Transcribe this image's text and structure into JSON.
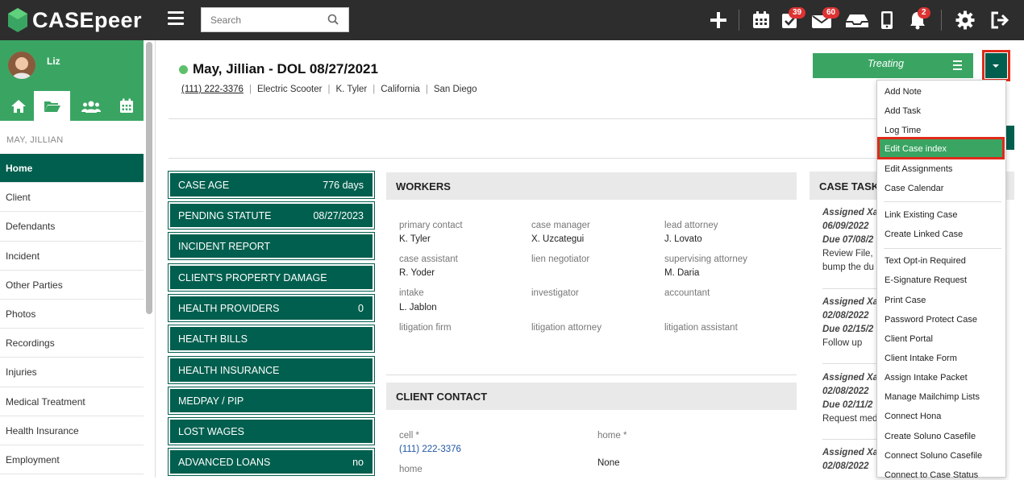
{
  "app": {
    "name": "CASEpeer"
  },
  "search": {
    "placeholder": "Search"
  },
  "topbar": {
    "tasks_badge": "39",
    "mail_badge": "60",
    "notifications_badge": "2"
  },
  "sidebar": {
    "user_name": "Liz",
    "case_name": "MAY, JILLIAN",
    "items": [
      {
        "label": "Home"
      },
      {
        "label": "Client"
      },
      {
        "label": "Defendants"
      },
      {
        "label": "Incident"
      },
      {
        "label": "Other Parties"
      },
      {
        "label": "Photos"
      },
      {
        "label": "Recordings"
      },
      {
        "label": "Injuries"
      },
      {
        "label": "Medical Treatment"
      },
      {
        "label": "Health Insurance"
      },
      {
        "label": "Employment"
      }
    ]
  },
  "case": {
    "title": "May, Jillian - DOL 08/27/2021",
    "phone": "(111) 222-3376",
    "type": "Electric Scooter",
    "worker": "K. Tyler",
    "state": "California",
    "city": "San Diego",
    "status": "Treating"
  },
  "metrics": [
    {
      "label": "CASE AGE",
      "value": "776 days"
    },
    {
      "label": "PENDING STATUTE",
      "value": "08/27/2023"
    },
    {
      "label": "INCIDENT REPORT",
      "value": ""
    },
    {
      "label": "CLIENT'S PROPERTY DAMAGE",
      "value": ""
    },
    {
      "label": "HEALTH PROVIDERS",
      "value": "0"
    },
    {
      "label": "HEALTH BILLS",
      "value": ""
    },
    {
      "label": "HEALTH INSURANCE",
      "value": ""
    },
    {
      "label": "MEDPAY / PIP",
      "value": ""
    },
    {
      "label": "LOST WAGES",
      "value": ""
    },
    {
      "label": "ADVANCED LOANS",
      "value": "no"
    }
  ],
  "workers": {
    "title": "WORKERS",
    "fields": [
      {
        "label": "primary contact",
        "value": "K. Tyler"
      },
      {
        "label": "case manager",
        "value": "X. Uzcategui"
      },
      {
        "label": "lead attorney",
        "value": "J. Lovato"
      },
      {
        "label": "case assistant",
        "value": "R. Yoder"
      },
      {
        "label": "lien negotiator",
        "value": ""
      },
      {
        "label": "supervising attorney",
        "value": "M. Daria"
      },
      {
        "label": "intake",
        "value": "L. Jablon"
      },
      {
        "label": "investigator",
        "value": ""
      },
      {
        "label": "accountant",
        "value": ""
      },
      {
        "label": "litigation firm",
        "value": ""
      },
      {
        "label": "litigation attorney",
        "value": ""
      },
      {
        "label": "litigation assistant",
        "value": ""
      }
    ]
  },
  "client_contact": {
    "title": "CLIENT CONTACT",
    "cell_label": "cell *",
    "cell_value": "(111) 222-3376",
    "home_label": "home *",
    "home_value": "None",
    "home2_label": "home"
  },
  "case_tasks": {
    "title": "CASE TASK",
    "tasks": [
      {
        "assigned": "Assigned Xa",
        "date": "06/09/2022",
        "due": "Due 07/08/2",
        "text1": "Review File,",
        "text2": "bump the du"
      },
      {
        "assigned": "Assigned Xa",
        "date": "02/08/2022",
        "due": "Due 02/15/2",
        "text1": "Follow up",
        "text2": ""
      },
      {
        "assigned": "Assigned Xa",
        "date": "02/08/2022",
        "due": "Due 02/11/2",
        "text1": "Request med",
        "text2": ""
      },
      {
        "assigned": "Assigned Xa",
        "date": "02/08/2022",
        "due": "",
        "text1": "",
        "text2": ""
      }
    ]
  },
  "menu": {
    "items_a": [
      "Add Note",
      "Add Task",
      "Log Time",
      "Edit Case index",
      "Edit Assignments",
      "Case Calendar"
    ],
    "items_b": [
      "Link Existing Case",
      "Create Linked Case"
    ],
    "items_c": [
      "Text Opt-in Required",
      "E-Signature Request",
      "Print Case",
      "Password Protect Case",
      "Client Portal",
      "Client Intake Form",
      "Assign Intake Packet",
      "Manage Mailchimp Lists",
      "Connect Hona",
      "Create Soluno Casefile",
      "Connect Soluno Casefile",
      "Connect to Case Status"
    ]
  },
  "colors": {
    "brand_green": "#3aa563",
    "dark_teal": "#005f4e",
    "topbar": "#2d2d2d",
    "highlight_red": "#e02a1a"
  }
}
